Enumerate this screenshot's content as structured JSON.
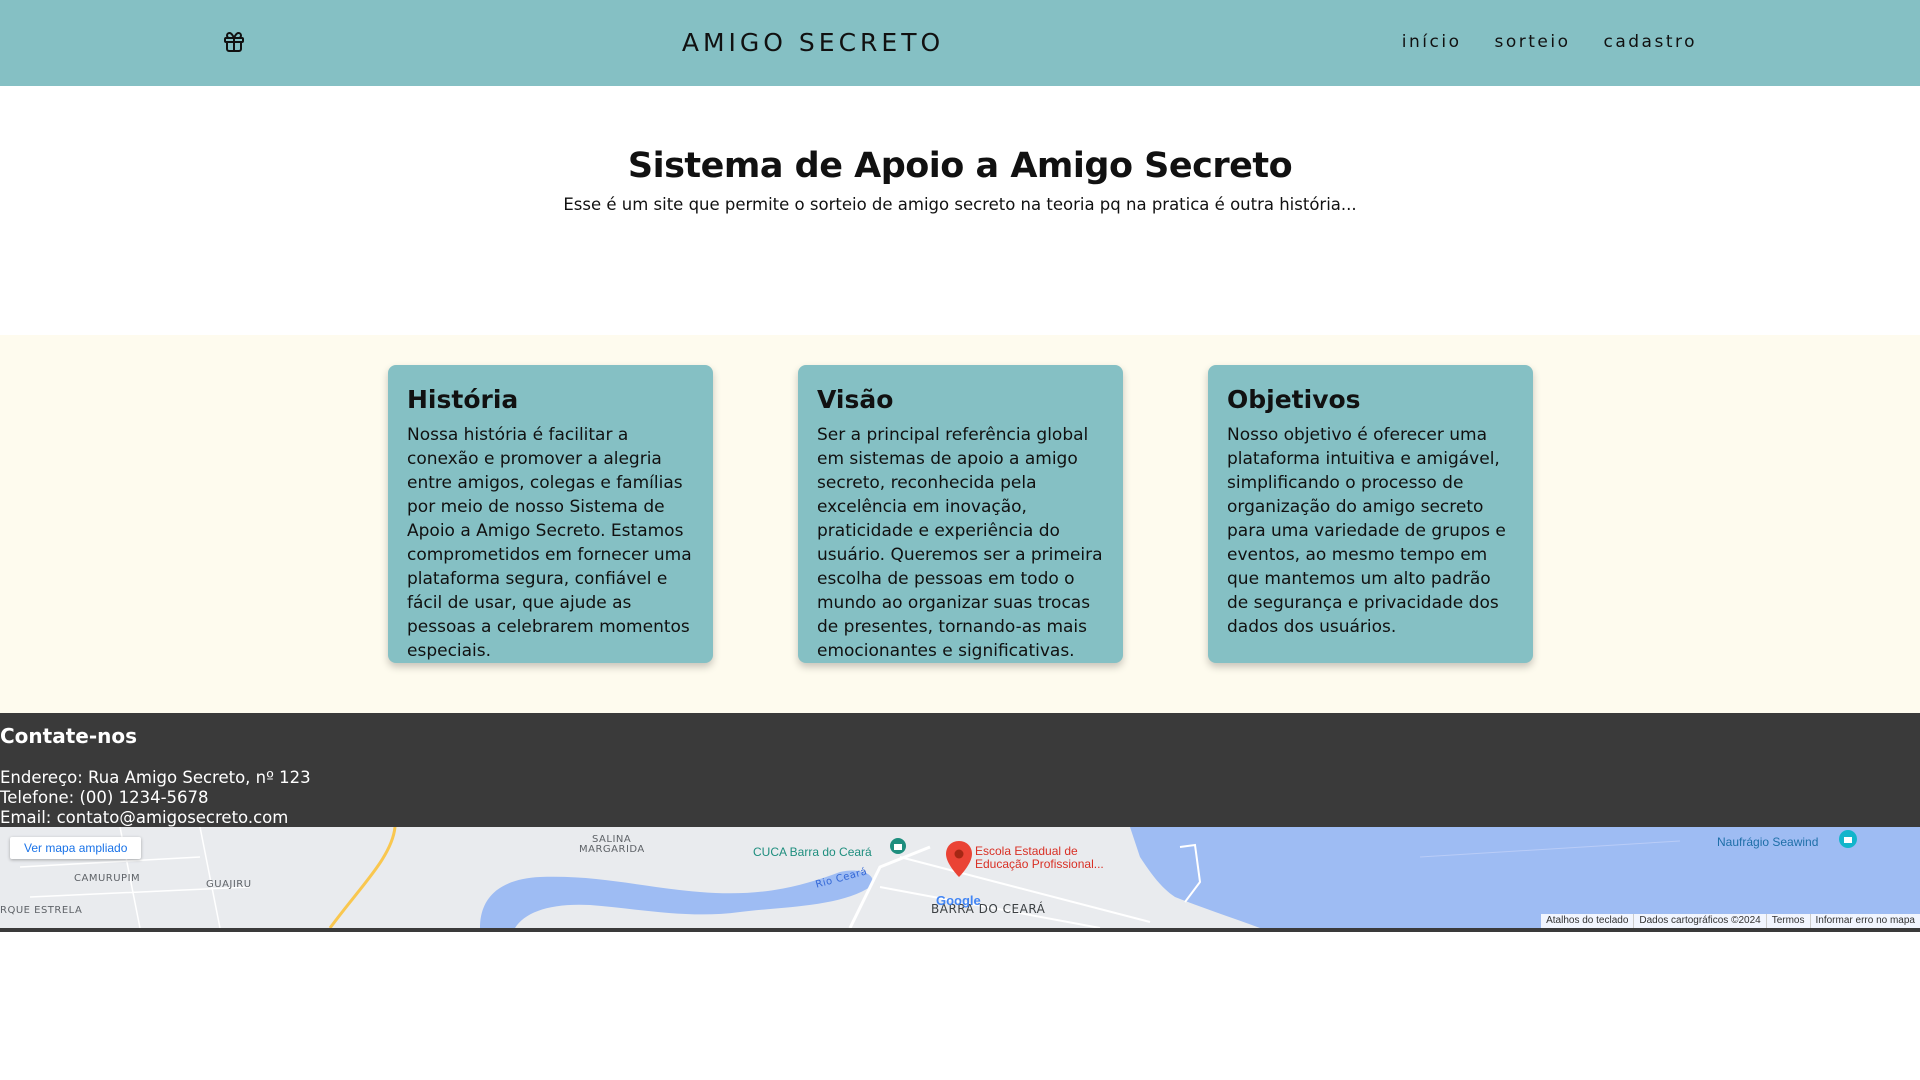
{
  "header": {
    "brand": "AMIGO SECRETO",
    "nav": [
      "início",
      "sorteio",
      "cadastro"
    ]
  },
  "hero": {
    "title": "Sistema de Apoio a Amigo Secreto",
    "subtitle": "Esse é um site que permite o sorteio de amigo secreto na teoria pq na pratica é outra história..."
  },
  "cards": [
    {
      "title": "História",
      "text": "Nossa história é facilitar a conexão e promover a alegria entre amigos, colegas e famílias por meio de nosso Sistema de Apoio a Amigo Secreto. Estamos comprometidos em fornecer uma plataforma segura, confiável e fácil de usar, que ajude as pessoas a celebrarem momentos especiais."
    },
    {
      "title": "Visão",
      "text": "Ser a principal referência global em sistemas de apoio a amigo secreto, reconhecida pela excelência em inovação, praticidade e experiência do usuário. Queremos ser a primeira escolha de pessoas em todo o mundo ao organizar suas trocas de presentes, tornando-as mais emocionantes e significativas."
    },
    {
      "title": "Objetivos",
      "text": "Nosso objetivo é oferecer uma plataforma intuitiva e amigável, simplificando o processo de organização do amigo secreto para uma variedade de grupos e eventos, ao mesmo tempo em que mantemos um alto padrão de segurança e privacidade dos dados dos usuários."
    }
  ],
  "footer": {
    "title": "Contate-nos",
    "address": "Endereço: Rua Amigo Secreto, nº 123",
    "phone": "Telefone: (00) 1234-5678",
    "email": "Email: contato@amigosecreto.com"
  },
  "map": {
    "view_larger": "Ver mapa ampliado",
    "labels": {
      "salina": "SALINA",
      "margarida": "MARGARIDA",
      "camurupim": "CAMURUPIM",
      "guajiru": "GUAJIRU",
      "estrela": "RQUE ESTRELA",
      "barra": "BARRA DO CEARÁ",
      "rio": "Rio Ceará"
    },
    "pois": {
      "cuca": "CUCA Barra do Ceará",
      "escola_line1": "Escola Estadual de",
      "escola_line2": "Educação Profissional...",
      "naufragio": "Naufrágio Seawind"
    },
    "google": "Google",
    "attribution": [
      "Atalhos do teclado",
      "Dados cartográficos ©2024",
      "Termos",
      "Informar erro no mapa"
    ]
  },
  "colors": {
    "header_bg": "#85c0c4",
    "card_bg": "#85c0c4",
    "section_bg": "#fefbee",
    "footer_bg": "#3a3a3a",
    "map_water": "#9ebcf3",
    "map_land": "#e9ebee",
    "map_marker": "#ea4335"
  },
  "icons": {
    "brand_icon": "gift-icon",
    "map_marker": "map-pin-icon"
  }
}
